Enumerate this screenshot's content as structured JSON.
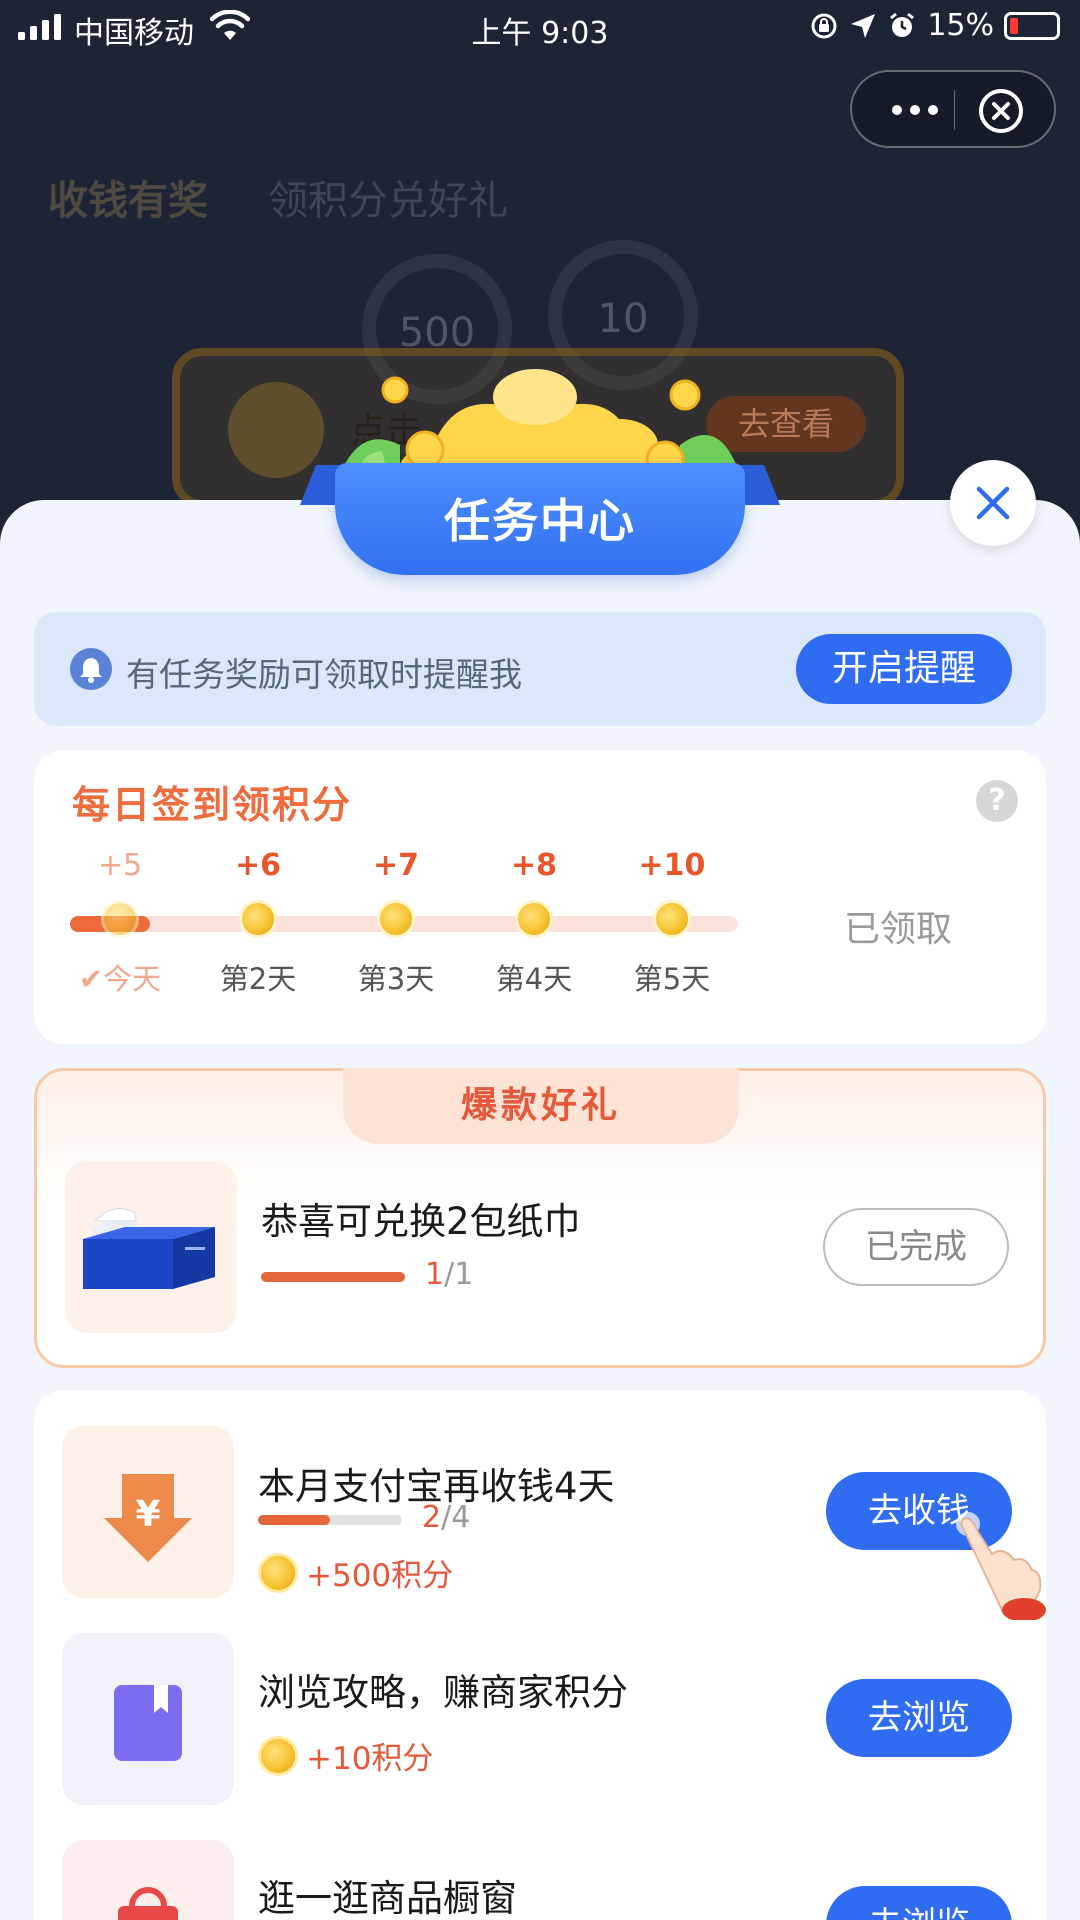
{
  "status_bar": {
    "carrier": "中国移动",
    "time": "上午 9:03",
    "battery": "15%",
    "icons": [
      "signal-icon",
      "wifi-icon",
      "orientation-lock-icon",
      "location-icon",
      "alarm-icon",
      "battery-icon"
    ]
  },
  "capsule": {
    "icons": [
      "more-icon",
      "close-circle-icon"
    ]
  },
  "background_page": {
    "title": "收钱有奖",
    "subtitle": "领积分兑好礼",
    "points": "500",
    "days": "10",
    "banner_text": "点击",
    "banner_button": "去查看"
  },
  "header": {
    "title": "任务中心"
  },
  "reminder": {
    "text": "有任务奖励可领取时提醒我",
    "button": "开启提醒"
  },
  "daily_signin": {
    "title": "每日签到领积分",
    "help": "?",
    "claimed_label": "已领取",
    "today_progress_fraction": 0.12,
    "days": [
      {
        "points": "+5",
        "label": "今天",
        "done": true
      },
      {
        "points": "+6",
        "label": "第2天",
        "done": false
      },
      {
        "points": "+7",
        "label": "第3天",
        "done": false
      },
      {
        "points": "+8",
        "label": "第4天",
        "done": false
      },
      {
        "points": "+10",
        "label": "第5天",
        "done": false
      }
    ]
  },
  "hot_gifts": {
    "tab": "爆款好礼",
    "item": {
      "title": "恭喜可兑换2包纸巾",
      "progress_done": "1",
      "progress_total": "/1",
      "progress_fraction": 1.0,
      "button": "已完成"
    }
  },
  "tasks": [
    {
      "title": "本月支付宝再收钱4天",
      "progress_done": "2",
      "progress_total": "/4",
      "progress_fraction": 0.5,
      "reward": "+500积分",
      "button": "去收钱",
      "icon": "yuan-arrow-icon"
    },
    {
      "title": "浏览攻略，赚商家积分",
      "reward": "+10积分",
      "button": "去浏览",
      "icon": "bookmark-icon"
    },
    {
      "title": "逛一逛商品橱窗",
      "button": "去浏览",
      "icon": "shopping-bag-icon"
    }
  ],
  "colors": {
    "primary_blue": "#2f6cf1",
    "accent_orange": "#e5583a",
    "sheet_bg": "#f1f5fc"
  }
}
